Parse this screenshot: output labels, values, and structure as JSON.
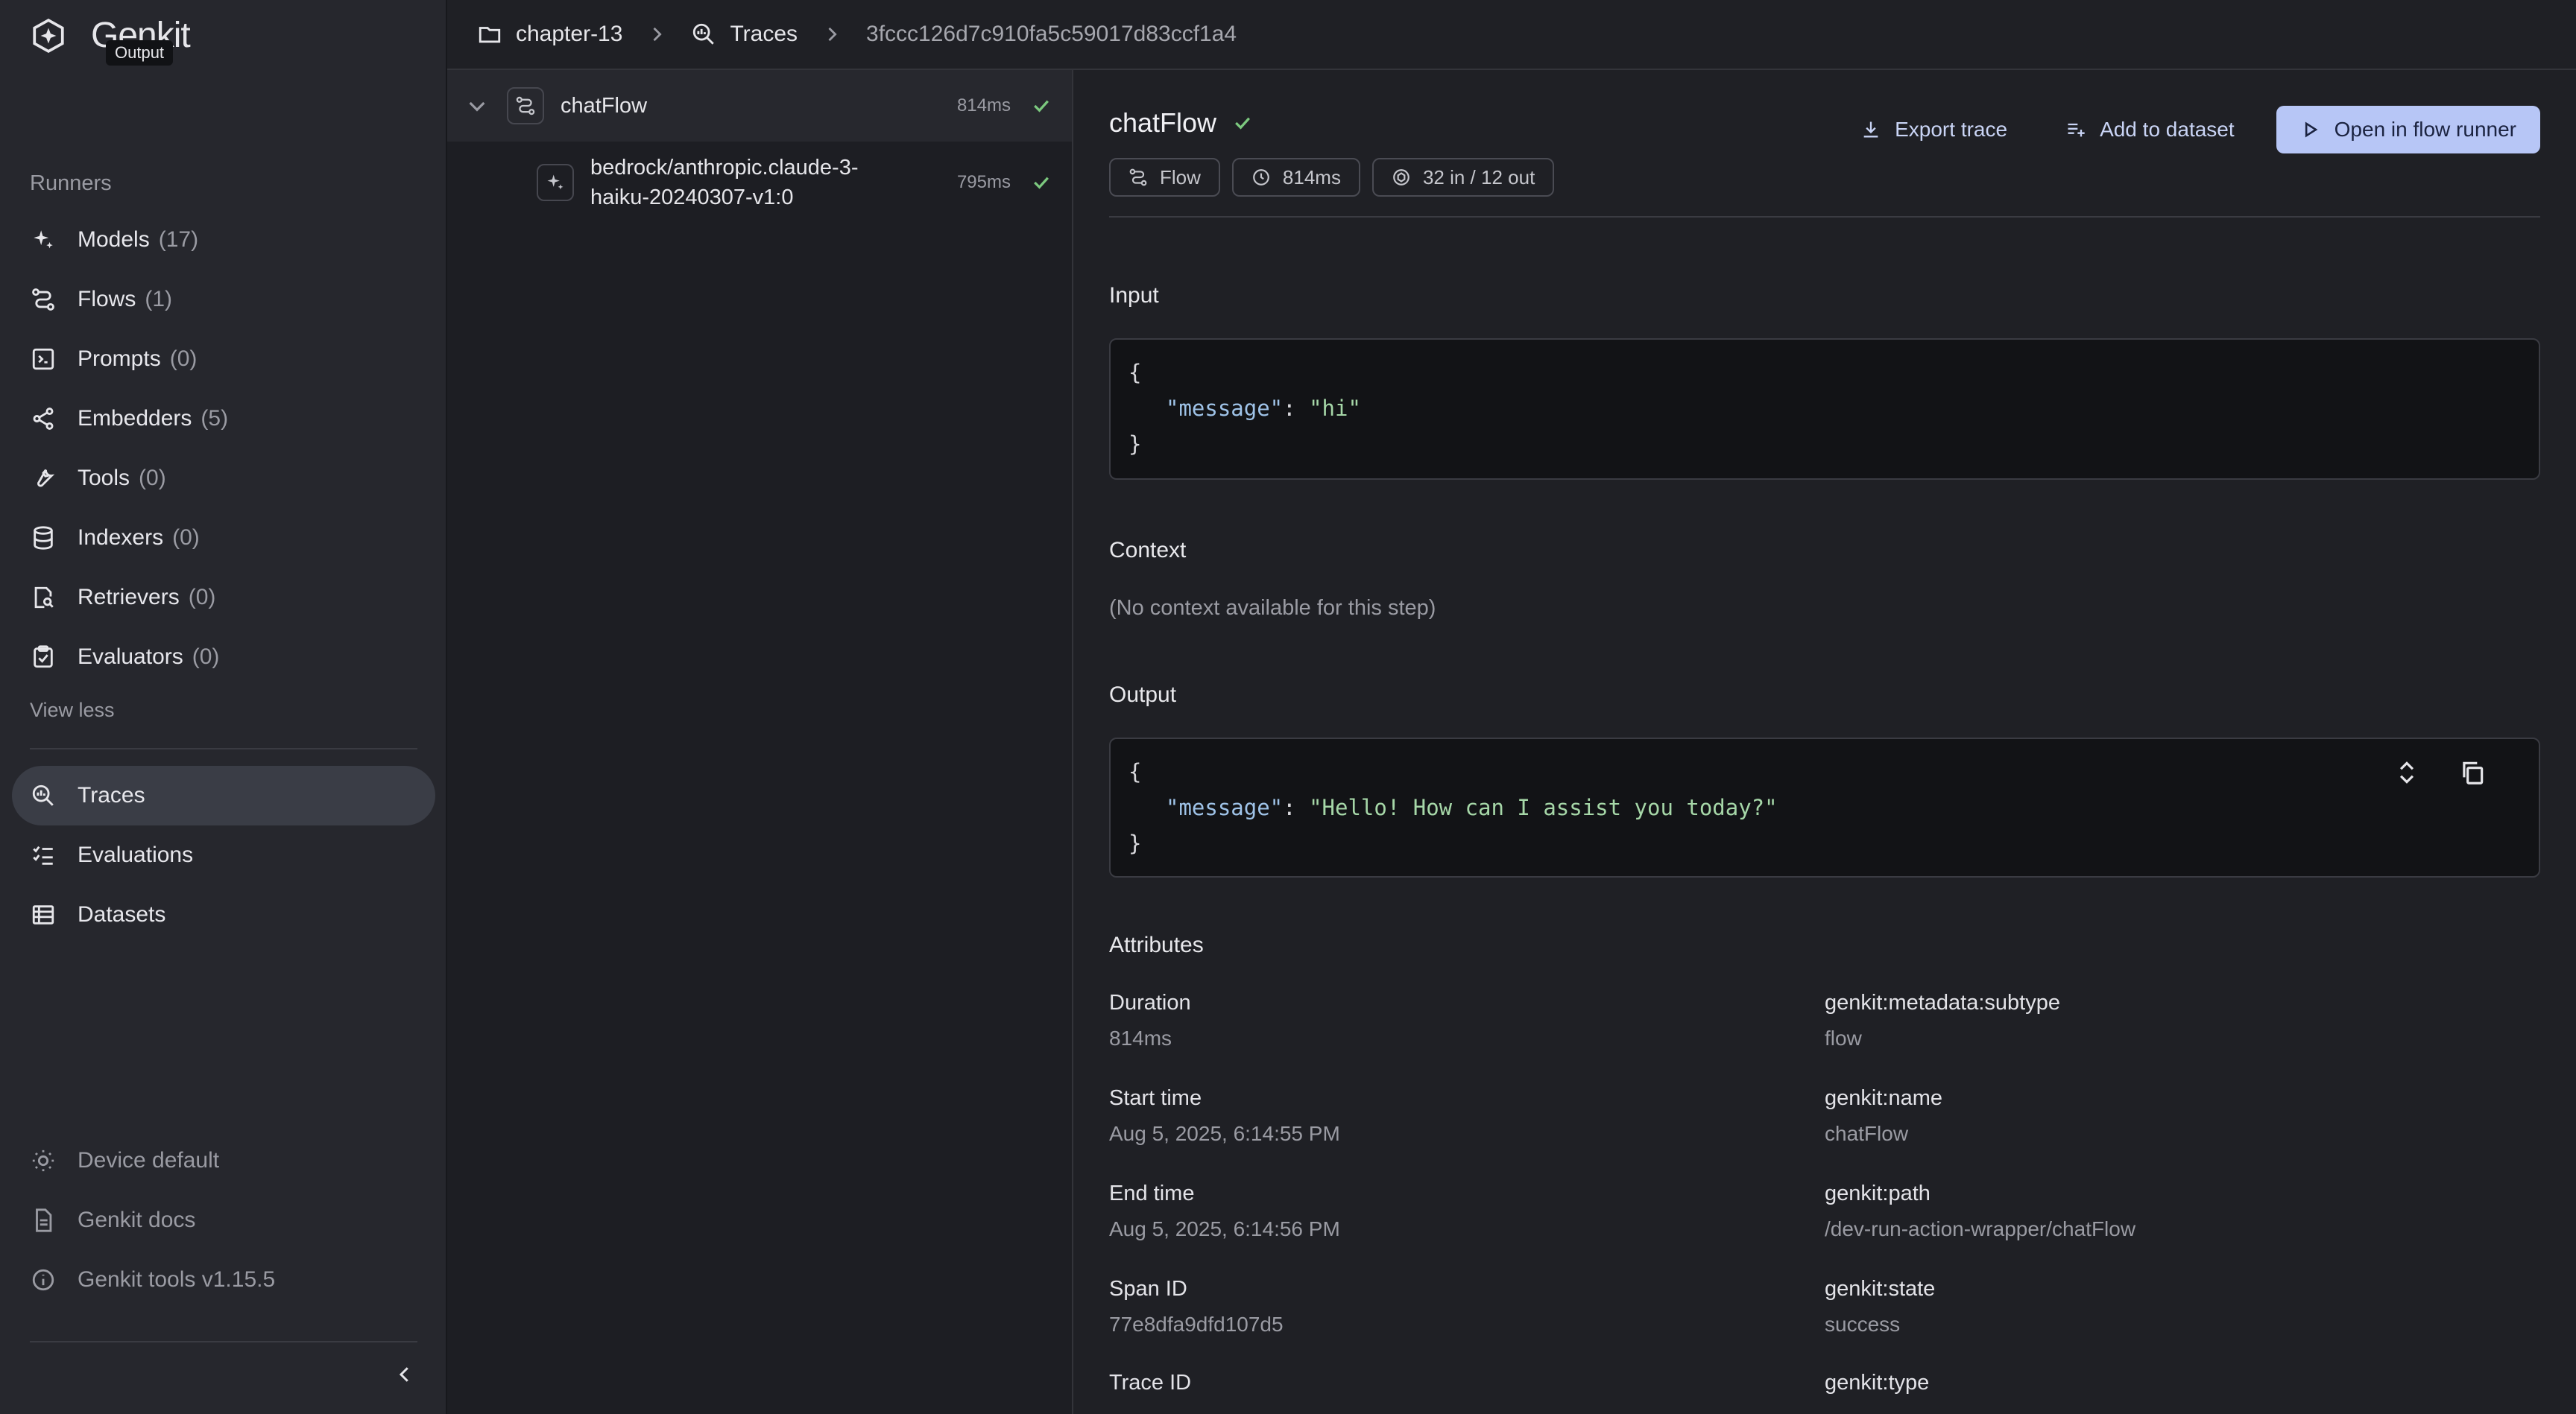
{
  "app": {
    "name": "Genkit",
    "tooltip": "Output"
  },
  "sidebar": {
    "section_label": "Runners",
    "runners": [
      {
        "label": "Models",
        "count": "(17)",
        "icon": "sparkle-icon"
      },
      {
        "label": "Flows",
        "count": "(1)",
        "icon": "flow-icon"
      },
      {
        "label": "Prompts",
        "count": "(0)",
        "icon": "prompt-icon"
      },
      {
        "label": "Embedders",
        "count": "(5)",
        "icon": "share-icon"
      },
      {
        "label": "Tools",
        "count": "(0)",
        "icon": "wrench-icon"
      },
      {
        "label": "Indexers",
        "count": "(0)",
        "icon": "database-icon"
      },
      {
        "label": "Retrievers",
        "count": "(0)",
        "icon": "search-doc-icon"
      },
      {
        "label": "Evaluators",
        "count": "(0)",
        "icon": "clipboard-check-icon"
      }
    ],
    "view_less": "View less",
    "main_nav": [
      {
        "label": "Traces",
        "icon": "trace-search-icon",
        "active": true
      },
      {
        "label": "Evaluations",
        "icon": "checklist-icon"
      },
      {
        "label": "Datasets",
        "icon": "table-icon"
      }
    ],
    "footer": [
      {
        "label": "Device default",
        "icon": "theme-icon"
      },
      {
        "label": "Genkit docs",
        "icon": "document-icon"
      },
      {
        "label": "Genkit tools v1.15.5",
        "icon": "info-icon"
      }
    ]
  },
  "breadcrumb": {
    "project": "chapter-13",
    "section": "Traces",
    "trace_id": "3fccc126d7c910fa5c59017d83ccf1a4"
  },
  "tree": {
    "root": {
      "name": "chatFlow",
      "duration": "814ms"
    },
    "child": {
      "name_line1": "bedrock/anthropic.claude-3-",
      "name_line2": "haiku-20240307-v1:0",
      "duration": "795ms"
    }
  },
  "detail": {
    "title": "chatFlow",
    "chips": {
      "type": "Flow",
      "duration": "814ms",
      "tokens": "32 in / 12 out"
    },
    "actions": {
      "export": "Export trace",
      "add_dataset": "Add to dataset",
      "open_runner": "Open in flow runner"
    },
    "input_label": "Input",
    "input": {
      "open": "{",
      "key": "\"message\"",
      "colon": ": ",
      "value": "\"hi\"",
      "close": "}"
    },
    "context_label": "Context",
    "context_text": "(No context available for this step)",
    "output_label": "Output",
    "output": {
      "open": "{",
      "key": "\"message\"",
      "colon": ": ",
      "value": "\"Hello! How can I assist you today?\"",
      "close": "}"
    },
    "attributes_label": "Attributes",
    "attributes_left": [
      {
        "label": "Duration",
        "value": "814ms"
      },
      {
        "label": "Start time",
        "value": "Aug 5, 2025, 6:14:55 PM"
      },
      {
        "label": "End time",
        "value": "Aug 5, 2025, 6:14:56 PM"
      },
      {
        "label": "Span ID",
        "value": "77e8dfa9dfd107d5"
      },
      {
        "label": "Trace ID",
        "value": ""
      }
    ],
    "attributes_right": [
      {
        "label": "genkit:metadata:subtype",
        "value": "flow"
      },
      {
        "label": "genkit:name",
        "value": "chatFlow"
      },
      {
        "label": "genkit:path",
        "value": "/dev-run-action-wrapper/chatFlow"
      },
      {
        "label": "genkit:state",
        "value": "success"
      },
      {
        "label": "genkit:type",
        "value": ""
      }
    ]
  },
  "colors": {
    "accent": "#b7c6f6",
    "success": "#7cc97f",
    "background": "#1f2025",
    "sidebar": "#26272d"
  }
}
